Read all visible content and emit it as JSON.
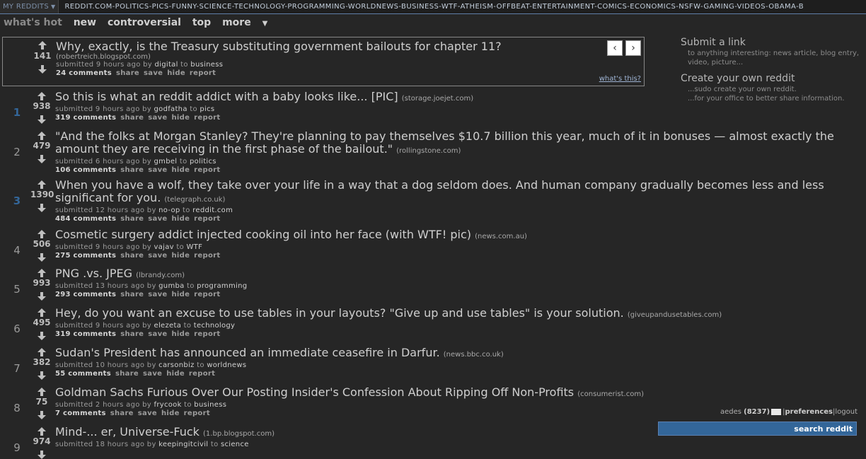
{
  "srbar": {
    "my_reddits": "MY REDDITS",
    "list": "REDDIT.COM-POLITICS-PICS-FUNNY-SCIENCE-TECHNOLOGY-PROGRAMMING-WORLDNEWS-BUSINESS-WTF-ATHEISM-OFFBEAT-ENTERTAINMENT-COMICS-ECONOMICS-NSFW-GAMING-VIDEOS-OBAMA-B"
  },
  "tabs": [
    "what's hot",
    "new",
    "controversial",
    "top",
    "more"
  ],
  "spotlight": {
    "score": "141",
    "title": "Why, exactly, is the Treasury substituting government bailouts for chapter 11?",
    "domain": "(robertreich.blogspot.com)",
    "submitted": "submitted 9 hours ago by",
    "user": "digital",
    "to": "to",
    "subreddit": "business",
    "comments": "24 comments",
    "prev": "‹",
    "next": "›",
    "whats_this": "what's this?"
  },
  "buttons": {
    "share": "share",
    "save": "save",
    "hide": "hide",
    "report": "report"
  },
  "links": [
    {
      "rank": "1",
      "score": "938",
      "title": "So this is what an reddit addict with a baby looks like... [PIC]",
      "domain": "(storage.joejet.com)",
      "submitted": "submitted 9 hours ago by",
      "user": "godfatha",
      "subreddit": "pics",
      "comments": "319 comments"
    },
    {
      "rank": "2",
      "score": "479",
      "title": "\"And the folks at Morgan Stanley? They're planning to pay themselves $10.7 billion this year, much of it in bonuses — almost exactly the amount they are receiving in the first phase of the bailout.\"",
      "domain": "(rollingstone.com)",
      "submitted": "submitted 6 hours ago by",
      "user": "gmbel",
      "subreddit": "politics",
      "comments": "106 comments"
    },
    {
      "rank": "3",
      "score": "1390",
      "title": "When you have a wolf, they take over your life in a way that a dog seldom does. And human company gradually becomes less and less significant for you.",
      "domain": "(telegraph.co.uk)",
      "submitted": "submitted 12 hours ago by",
      "user": "no-op",
      "subreddit": "reddit.com",
      "comments": "484 comments"
    },
    {
      "rank": "4",
      "score": "506",
      "title": "Cosmetic surgery addict injected cooking oil into her face (with WTF! pic)",
      "domain": "(news.com.au)",
      "submitted": "submitted 9 hours ago by",
      "user": "vajav",
      "subreddit": "WTF",
      "comments": "275 comments"
    },
    {
      "rank": "5",
      "score": "993",
      "title": "PNG .vs. JPEG",
      "domain": "(lbrandy.com)",
      "submitted": "submitted 13 hours ago by",
      "user": "gumba",
      "subreddit": "programming",
      "comments": "293 comments"
    },
    {
      "rank": "6",
      "score": "495",
      "title": "Hey, do you want an excuse to use tables in your layouts? \"Give up and use tables\" is your solution.",
      "domain": "(giveupandusetables.com)",
      "submitted": "submitted 9 hours ago by",
      "user": "elezeta",
      "subreddit": "technology",
      "comments": "319 comments"
    },
    {
      "rank": "7",
      "score": "382",
      "title": "Sudan's President has announced an immediate ceasefire in Darfur.",
      "domain": "(news.bbc.co.uk)",
      "submitted": "submitted 10 hours ago by",
      "user": "carsonbiz",
      "subreddit": "worldnews",
      "comments": "55 comments"
    },
    {
      "rank": "8",
      "score": "75",
      "title": "Goldman Sachs Furious Over Our Posting Insider's Confession About Ripping Off Non-Profits",
      "domain": "(consumerist.com)",
      "submitted": "submitted 2 hours ago by",
      "user": "frycook",
      "subreddit": "business",
      "comments": "7 comments"
    },
    {
      "rank": "9",
      "score": "974",
      "title": "Mind-... er, Universe-Fuck",
      "domain": "(1.bp.blogspot.com)",
      "submitted": "submitted 18 hours ago by",
      "user": "keepingitcivil",
      "subreddit": "science",
      "comments": ""
    }
  ],
  "sidebar": {
    "submit_title": "Submit a link",
    "submit_desc": "to anything interesting: news article, blog entry, video, picture...",
    "create_title": "Create your own reddit",
    "create_desc1": "...sudo create your own reddit.",
    "create_desc2": "...for your office to better share information."
  },
  "user": {
    "name": "aedes",
    "karma": "(8237)",
    "preferences": "preferences",
    "logout": "logout"
  },
  "search": {
    "label": "search reddit"
  }
}
